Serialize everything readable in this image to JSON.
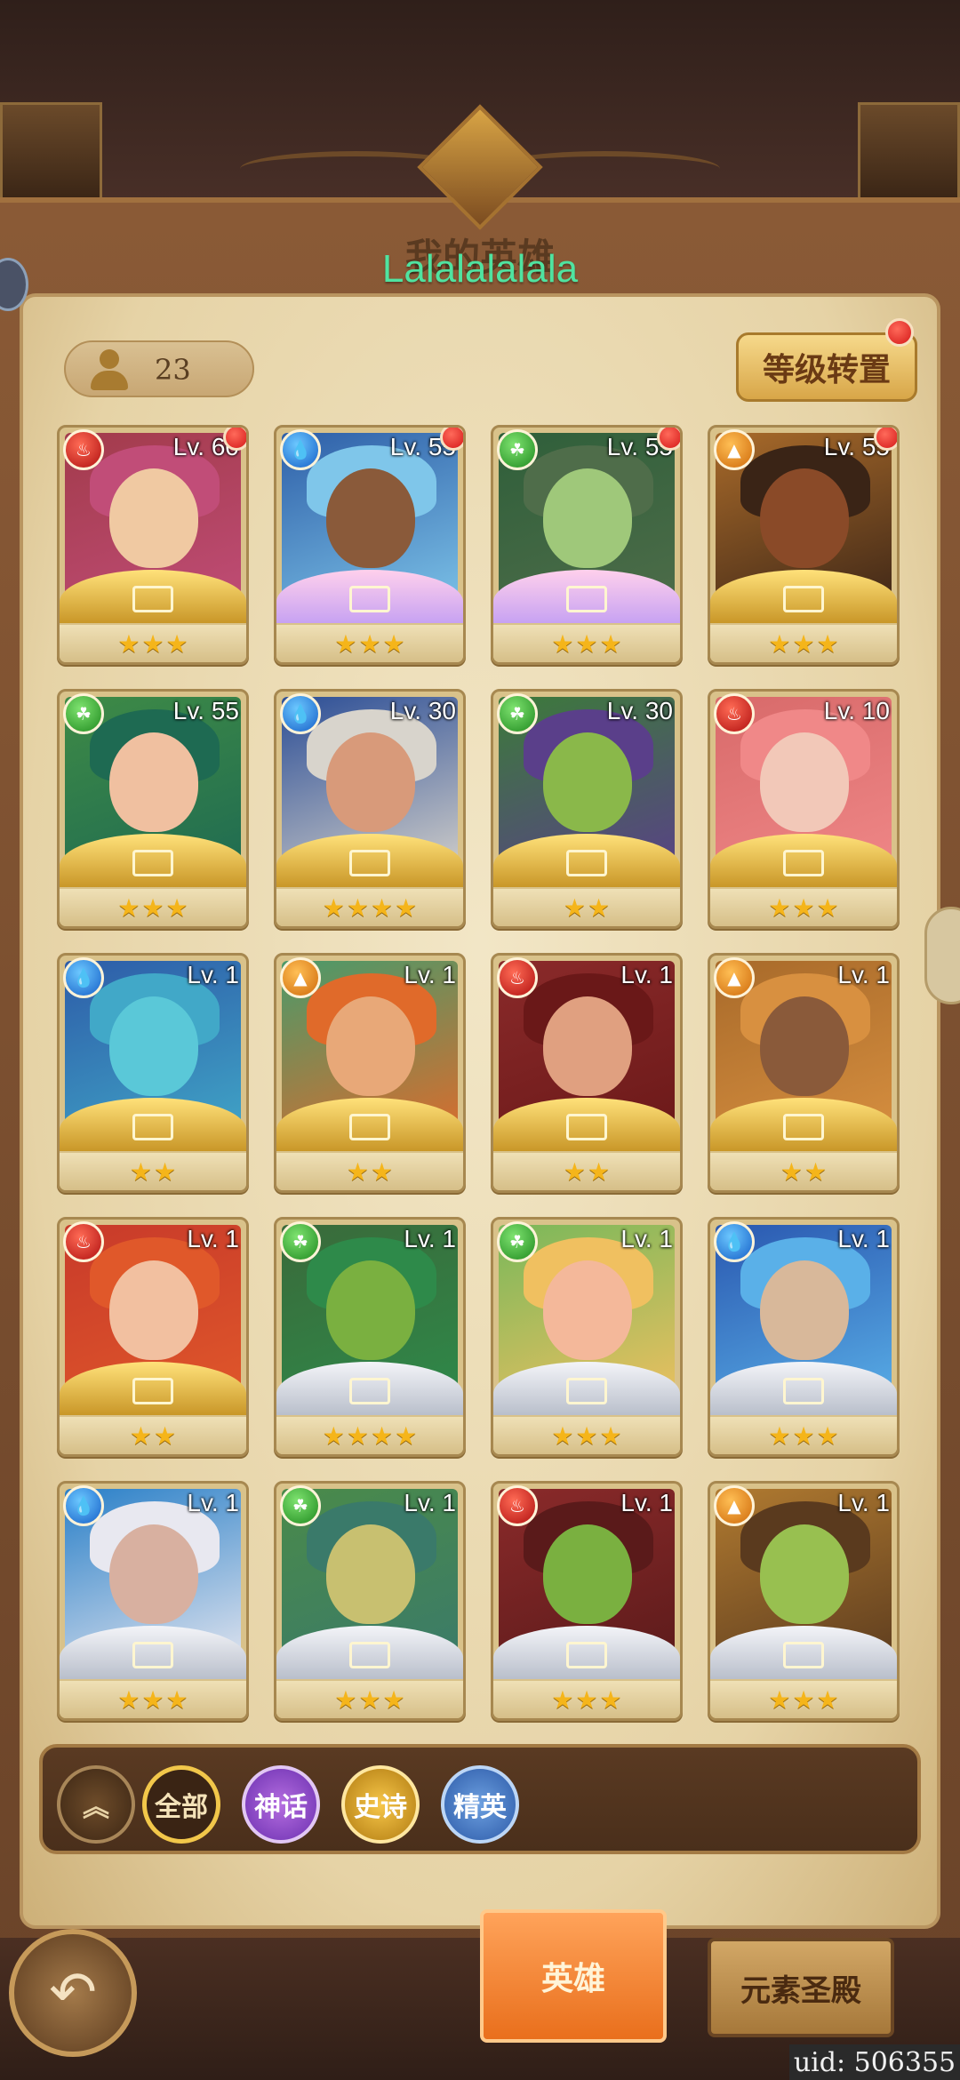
{
  "header": {
    "title": "我的英雄",
    "nickname": "Lalalalalala"
  },
  "hero_count": "23",
  "transfer_button": "等级转置",
  "heroes": [
    {
      "element": "fire",
      "level": "Lv. 60",
      "stars": 3,
      "frame": "gold",
      "palette": [
        "#a23b4b",
        "#c14d78",
        "#f0c9a2"
      ],
      "badge": true
    },
    {
      "element": "water",
      "level": "Lv. 55",
      "stars": 3,
      "frame": "pink",
      "palette": [
        "#2e5fa8",
        "#7fc6ea",
        "#8a5a3a"
      ],
      "badge": true
    },
    {
      "element": "nature",
      "level": "Lv. 55",
      "stars": 3,
      "frame": "pink",
      "palette": [
        "#2f5f3a",
        "#4f6d4a",
        "#9fc87a"
      ],
      "badge": true
    },
    {
      "element": "earth",
      "level": "Lv. 55",
      "stars": 3,
      "frame": "gold",
      "palette": [
        "#a86a2a",
        "#3a2416",
        "#8a4a28"
      ],
      "badge": true
    },
    {
      "element": "nature",
      "level": "Lv. 55",
      "stars": 3,
      "frame": "gold",
      "palette": [
        "#3e8a46",
        "#1e6a52",
        "#f0c0a0"
      ],
      "badge": false
    },
    {
      "element": "water",
      "level": "Lv. 30",
      "stars": 4,
      "frame": "gold",
      "palette": [
        "#2c4e96",
        "#d8d4cc",
        "#d89a7a"
      ],
      "badge": false
    },
    {
      "element": "nature",
      "level": "Lv. 30",
      "stars": 2,
      "frame": "gold",
      "palette": [
        "#3c7a3a",
        "#5a3f8a",
        "#8ab84a"
      ],
      "badge": false
    },
    {
      "element": "fire",
      "level": "Lv. 10",
      "stars": 3,
      "frame": "gold",
      "palette": [
        "#d86a6a",
        "#f08888",
        "#f2c8b8"
      ],
      "badge": false
    },
    {
      "element": "water",
      "level": "Lv. 1",
      "stars": 2,
      "frame": "gold",
      "palette": [
        "#2d5ca8",
        "#41a8c8",
        "#5ac8d8"
      ],
      "badge": false
    },
    {
      "element": "earth",
      "level": "Lv. 1",
      "stars": 2,
      "frame": "gold",
      "palette": [
        "#4a9a6a",
        "#e06a2a",
        "#e8a878"
      ],
      "badge": false
    },
    {
      "element": "fire",
      "level": "Lv. 1",
      "stars": 2,
      "frame": "gold",
      "palette": [
        "#8a2a2a",
        "#6a1818",
        "#e0a080"
      ],
      "badge": false
    },
    {
      "element": "earth",
      "level": "Lv. 1",
      "stars": 2,
      "frame": "gold",
      "palette": [
        "#a86a2a",
        "#d89040",
        "#8a5a3a"
      ],
      "badge": false
    },
    {
      "element": "fire",
      "level": "Lv. 1",
      "stars": 2,
      "frame": "gold",
      "palette": [
        "#c83a2a",
        "#e0582a",
        "#f2c0a0"
      ],
      "badge": false
    },
    {
      "element": "nature",
      "level": "Lv. 1",
      "stars": 4,
      "frame": "silver",
      "palette": [
        "#3a6a3a",
        "#2e8a4a",
        "#7ab040"
      ],
      "badge": false
    },
    {
      "element": "nature",
      "level": "Lv. 1",
      "stars": 3,
      "frame": "silver",
      "palette": [
        "#7ab85a",
        "#f0c060",
        "#f4b89a"
      ],
      "badge": false
    },
    {
      "element": "water",
      "level": "Lv. 1",
      "stars": 3,
      "frame": "silver",
      "palette": [
        "#2a58b0",
        "#5ab0e8",
        "#d8b89a"
      ],
      "badge": false
    },
    {
      "element": "water",
      "level": "Lv. 1",
      "stars": 3,
      "frame": "silver",
      "palette": [
        "#2a80c8",
        "#e8e8f0",
        "#d8b0a0"
      ],
      "badge": false
    },
    {
      "element": "nature",
      "level": "Lv. 1",
      "stars": 3,
      "frame": "silver",
      "palette": [
        "#4a8a4a",
        "#3a7a6a",
        "#c8c070"
      ],
      "badge": false
    },
    {
      "element": "fire",
      "level": "Lv. 1",
      "stars": 3,
      "frame": "silver",
      "palette": [
        "#8a2a2a",
        "#5a1a1a",
        "#7ab040"
      ],
      "badge": false
    },
    {
      "element": "earth",
      "level": "Lv. 1",
      "stars": 3,
      "frame": "silver",
      "palette": [
        "#b07a30",
        "#5a3a1e",
        "#98c050"
      ],
      "badge": false
    }
  ],
  "filters": {
    "all": "全部",
    "myth": "神话",
    "epic": "史诗",
    "elite": "精英"
  },
  "bottom_tabs": {
    "heroes": "英雄",
    "temple": "元素圣殿"
  },
  "uid": "uid: 506355",
  "colors": {
    "fire": "#d41818",
    "water": "#1660c8",
    "nature": "#1f8a1f",
    "earth": "#cf6a0a",
    "star": "#f5b51a"
  }
}
